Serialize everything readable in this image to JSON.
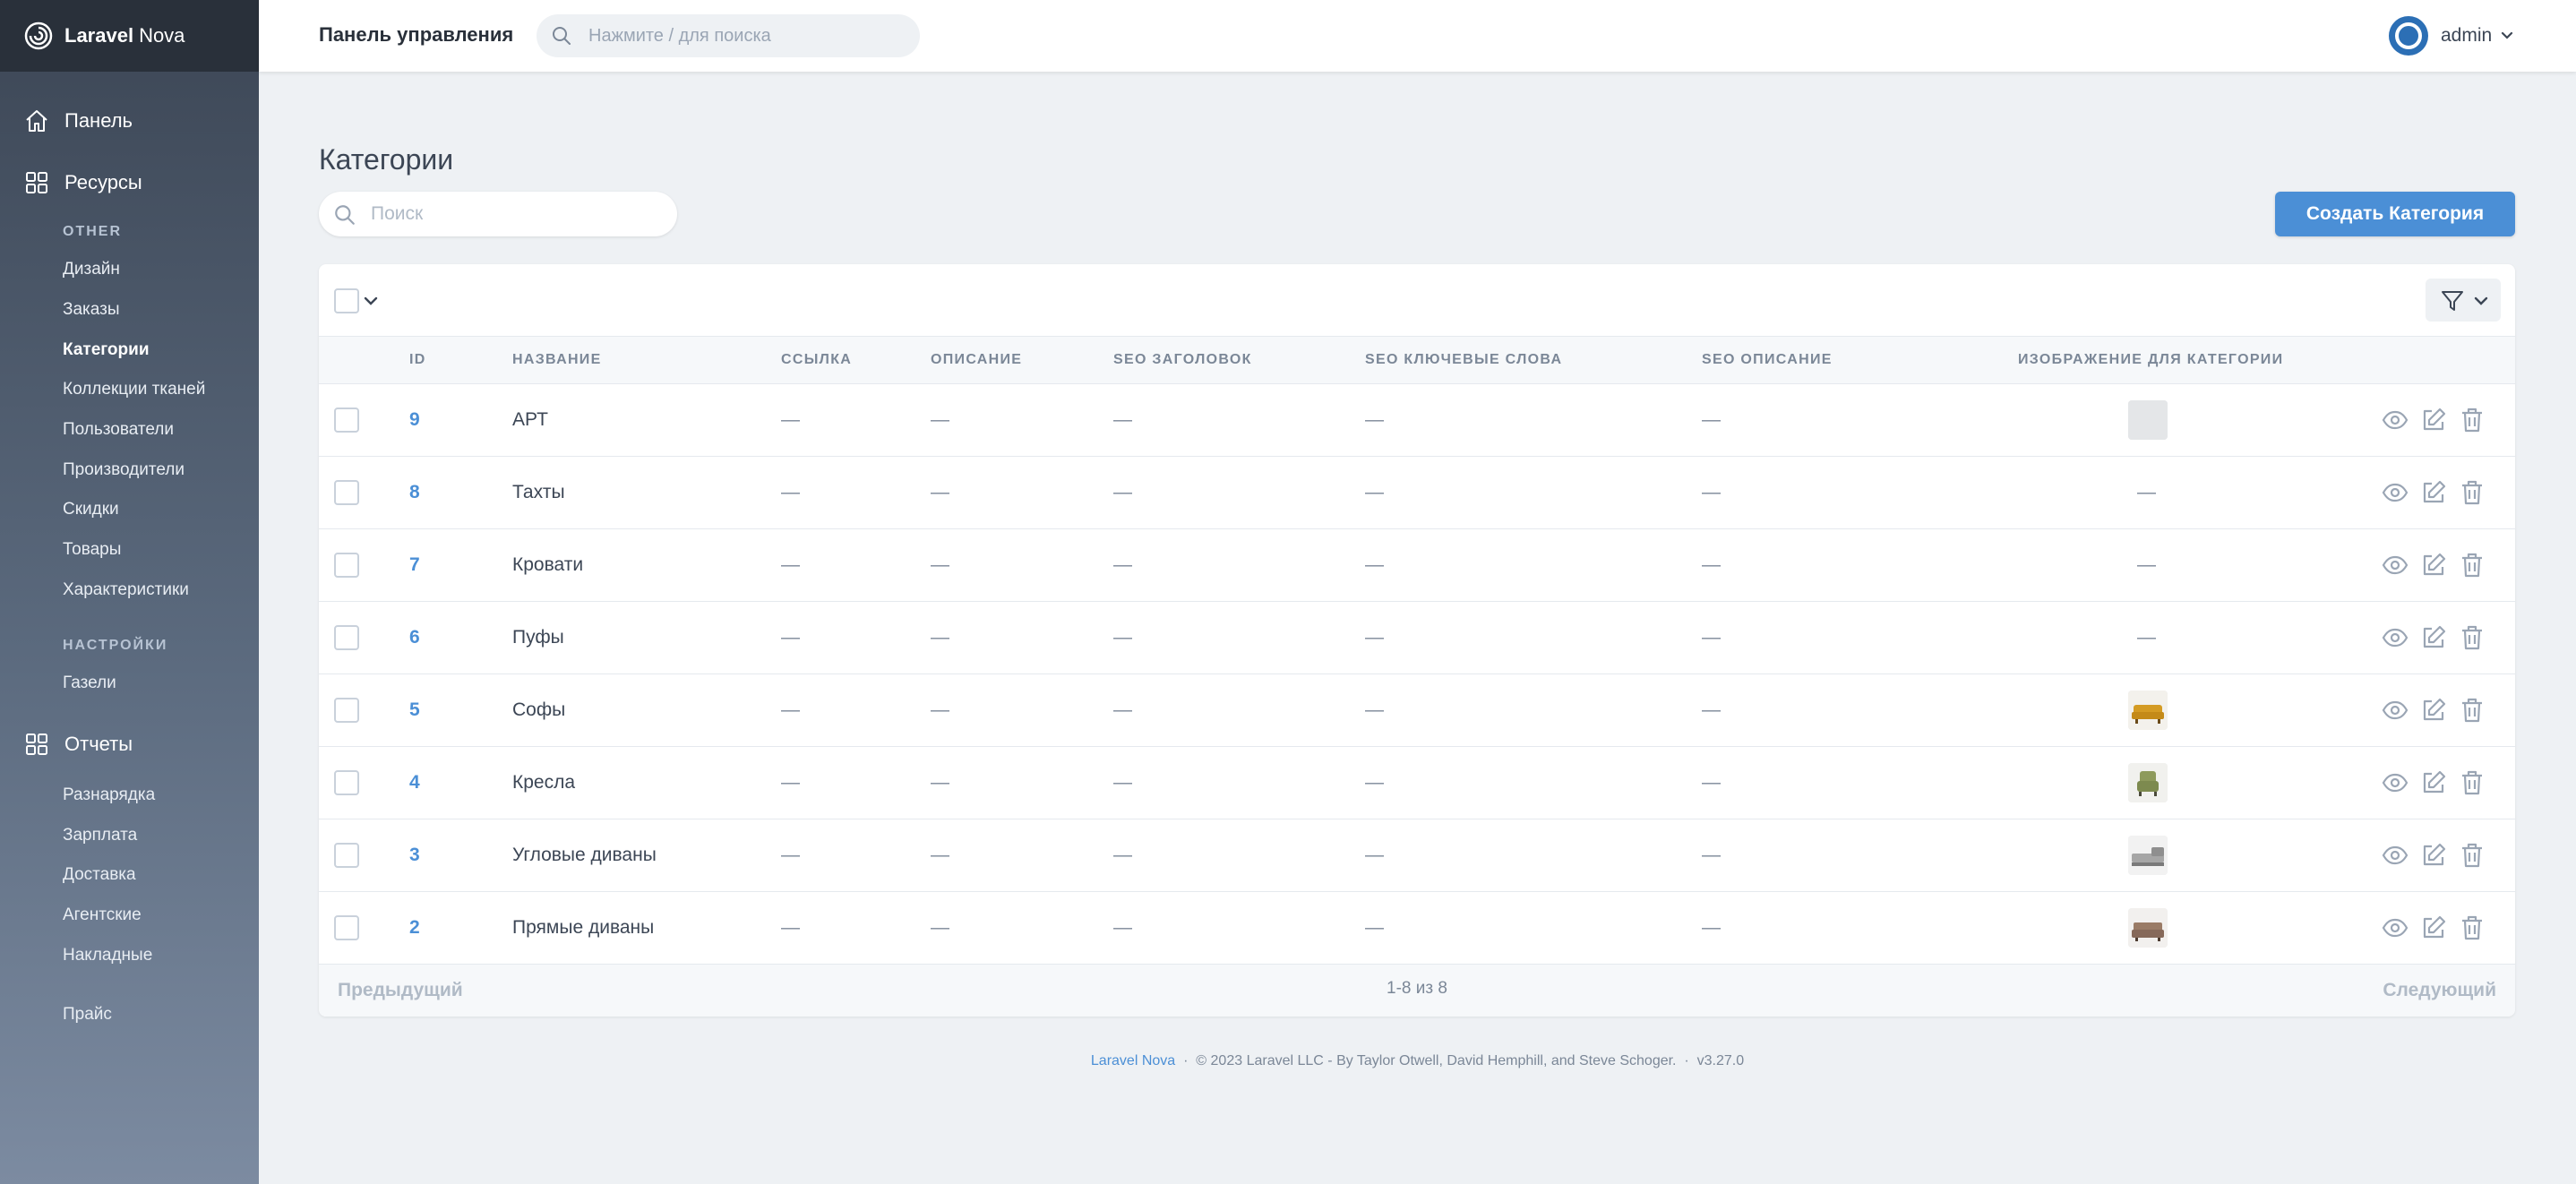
{
  "brand": {
    "name_bold": "Laravel",
    "name": "Nova"
  },
  "sidebar": {
    "dashboard": "Панель",
    "resources": "Ресурсы",
    "group_other": "OTHER",
    "other_items": [
      "Дизайн",
      "Заказы",
      "Категории",
      "Коллекции тканей",
      "Пользователи",
      "Производители",
      "Скидки",
      "Товары",
      "Характеристики"
    ],
    "group_settings": "НАСТРОЙКИ",
    "settings_items": [
      "Газели"
    ],
    "reports": "Отчеты",
    "report_items": [
      "Разнарядка",
      "Зарплата",
      "Доставка",
      "Агентские",
      "Накладные"
    ],
    "price": "Прайс"
  },
  "header": {
    "title": "Панель управления",
    "search_placeholder": "Нажмите / для поиска",
    "user": "admin"
  },
  "page": {
    "title": "Категории",
    "search_placeholder": "Поиск",
    "create_label": "Создать Категория"
  },
  "table": {
    "columns": [
      "ID",
      "НАЗВАНИЕ",
      "ССЫЛКА",
      "ОПИСАНИЕ",
      "SEO ЗАГОЛОВОК",
      "SEO КЛЮЧЕВЫЕ СЛОВА",
      "SEO ОПИСАНИЕ",
      "ИЗОБРАЖЕНИЕ ДЛЯ КАТЕГОРИИ"
    ],
    "empty": "—",
    "rows": [
      {
        "id": "9",
        "name": "АРТ",
        "image": "placeholder"
      },
      {
        "id": "8",
        "name": "Тахты",
        "image": ""
      },
      {
        "id": "7",
        "name": "Кровати",
        "image": ""
      },
      {
        "id": "6",
        "name": "Пуфы",
        "image": ""
      },
      {
        "id": "5",
        "name": "Софы",
        "image": "yellow-sofa"
      },
      {
        "id": "4",
        "name": "Кресла",
        "image": "green-armchair"
      },
      {
        "id": "3",
        "name": "Угловые диваны",
        "image": "grey-corner-sofa"
      },
      {
        "id": "2",
        "name": "Прямые диваны",
        "image": "brown-sofa"
      }
    ]
  },
  "pager": {
    "prev": "Предыдущий",
    "info": "1-8 из 8",
    "next": "Следующий"
  },
  "footer": {
    "link": "Laravel Nova",
    "text": "© 2023 Laravel LLC - By Taylor Otwell, David Hemphill, and Steve Schoger.",
    "version": "v3.27.0",
    "sep": "·"
  },
  "colors": {
    "accent": "#4b8fd6",
    "sidebar": "#3c4655",
    "brand_bar": "#29303a"
  }
}
